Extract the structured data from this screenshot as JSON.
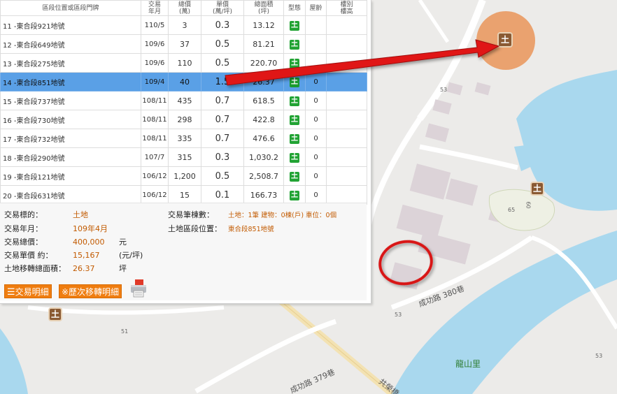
{
  "table": {
    "headers": {
      "address": "區段位置或區段門牌",
      "date": "交易\n年月",
      "total": "總價\n(萬)",
      "unit": "單價\n(萬/坪)",
      "area": "總面積\n(坪)",
      "type": "型態",
      "age": "屋齡",
      "floor": "樓別\n樓高"
    },
    "rows": [
      {
        "address": "11 -東合段921地號",
        "date": "110/5",
        "total": "3",
        "unit": "0.3",
        "area": "13.12",
        "type": "土",
        "age": "",
        "floor": "",
        "selected": false
      },
      {
        "address": "12 -東合段649地號",
        "date": "109/6",
        "total": "37",
        "unit": "0.5",
        "area": "81.21",
        "type": "土",
        "age": "",
        "floor": "",
        "selected": false
      },
      {
        "address": "13 -東合段275地號",
        "date": "109/6",
        "total": "110",
        "unit": "0.5",
        "area": "220.70",
        "type": "土",
        "age": "",
        "floor": "",
        "selected": false
      },
      {
        "address": "14 -東合段851地號",
        "date": "109/4",
        "total": "40",
        "unit": "1.5",
        "area": "26.37",
        "type": "土",
        "age": "0",
        "floor": "",
        "selected": true
      },
      {
        "address": "15 -東合段737地號",
        "date": "108/11",
        "total": "435",
        "unit": "0.7",
        "area": "618.5",
        "type": "土",
        "age": "0",
        "floor": "",
        "selected": false
      },
      {
        "address": "16 -東合段730地號",
        "date": "108/11",
        "total": "298",
        "unit": "0.7",
        "area": "422.8",
        "type": "土",
        "age": "0",
        "floor": "",
        "selected": false
      },
      {
        "address": "17 -東合段732地號",
        "date": "108/11",
        "total": "335",
        "unit": "0.7",
        "area": "476.6",
        "type": "土",
        "age": "0",
        "floor": "",
        "selected": false
      },
      {
        "address": "18 -東合段290地號",
        "date": "107/7",
        "total": "315",
        "unit": "0.3",
        "area": "1,030.2",
        "type": "土",
        "age": "0",
        "floor": "",
        "selected": false
      },
      {
        "address": "19 -東合段121地號",
        "date": "106/12",
        "total": "1,200",
        "unit": "0.5",
        "area": "2,508.7",
        "type": "土",
        "age": "0",
        "floor": "",
        "selected": false
      },
      {
        "address": "20 -東合段631地號",
        "date": "106/12",
        "total": "15",
        "unit": "0.1",
        "area": "166.73",
        "type": "土",
        "age": "0",
        "floor": "",
        "selected": false
      }
    ]
  },
  "detail": {
    "target_label": "交易標的：",
    "target_value": "土地",
    "date_label": "交易年月：",
    "date_value": "109年4月",
    "total_label": "交易總價：",
    "total_value": "400,000",
    "total_unit": "元",
    "unit_price_label": "交易單價 約：",
    "unit_price_value": "15,167",
    "unit_price_unit": "(元/坪)",
    "area_label": "土地移轉總面積：",
    "area_value": "26.37",
    "area_unit": "坪",
    "count_label": "交易筆棟數：",
    "count_value": "土地：1筆 建物：0棟(戶) 車位：0個",
    "location_label": "土地區段位置：",
    "location_value": "東合段851地號"
  },
  "buttons": {
    "detail": "交易明細",
    "history": "※歷次移轉明細"
  },
  "map": {
    "roads": {
      "chenggong_380": "成功路 380巷",
      "chenggong_379": "成功路 379巷",
      "gongyuan": "共榮橋"
    },
    "village": "龍山里",
    "markers": {
      "m1": "53",
      "m2": "53",
      "m3": "65",
      "m4": "53",
      "m5": "51",
      "m6": "60"
    },
    "pin_glyph": "土"
  },
  "colors": {
    "water": "#a9d8ee",
    "selected_row": "#5aa0e6",
    "accent_orange": "#ef7d10",
    "badge_green": "#22a334",
    "arrow_red": "#e01515",
    "circle_red": "#d81818",
    "highlight_halo": "#e98a45"
  }
}
